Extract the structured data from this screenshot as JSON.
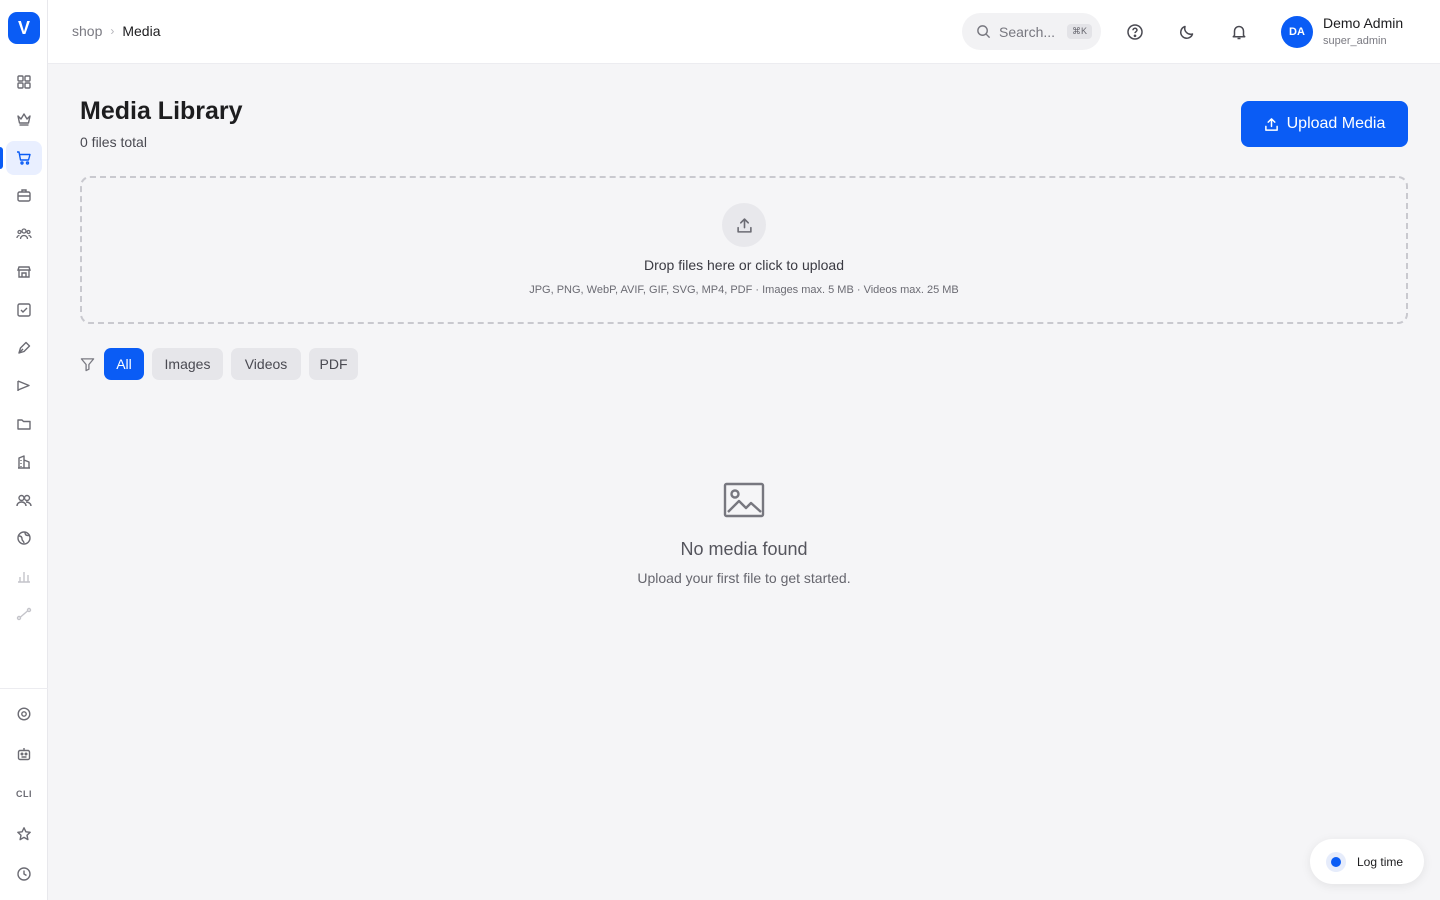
{
  "brand": {
    "logo_letter": "V",
    "accent": "#0a5cf5"
  },
  "sidebar": {
    "items": [
      {
        "name": "dashboard-icon"
      },
      {
        "name": "crown-icon"
      },
      {
        "name": "cart-icon",
        "active": true
      },
      {
        "name": "briefcase-icon"
      },
      {
        "name": "team-icon"
      },
      {
        "name": "store-icon"
      },
      {
        "name": "checklist-icon"
      },
      {
        "name": "pen-icon"
      },
      {
        "name": "megaphone-icon"
      },
      {
        "name": "folder-icon"
      },
      {
        "name": "building-icon"
      },
      {
        "name": "users-icon"
      },
      {
        "name": "globe-icon"
      },
      {
        "name": "bar-chart-icon"
      },
      {
        "name": "route-icon"
      }
    ],
    "bottom_items": [
      {
        "name": "settings-icon"
      },
      {
        "name": "robot-icon"
      },
      {
        "name": "cli-icon",
        "label": "CLI"
      },
      {
        "name": "star-icon"
      },
      {
        "name": "clock-icon"
      }
    ]
  },
  "header": {
    "breadcrumb": {
      "parent": "shop",
      "current": "Media"
    },
    "search": {
      "placeholder": "Search...",
      "shortcut": "⌘K"
    },
    "user": {
      "initials": "DA",
      "name": "Demo Admin",
      "role": "super_admin"
    }
  },
  "main": {
    "title": "Media Library",
    "subtitle": "0 files total",
    "upload_button": "Upload Media",
    "dropzone": {
      "title": "Drop files here or click to upload",
      "hint": "JPG, PNG, WebP, AVIF, GIF, SVG, MP4, PDF · Images max. 5 MB · Videos max. 25 MB"
    },
    "filters": [
      {
        "label": "All",
        "active": true
      },
      {
        "label": "Images",
        "active": false
      },
      {
        "label": "Videos",
        "active": false
      },
      {
        "label": "PDF",
        "active": false
      }
    ],
    "empty": {
      "title": "No media found",
      "subtitle": "Upload your first file to get started."
    }
  },
  "log_time": {
    "label": "Log time"
  }
}
